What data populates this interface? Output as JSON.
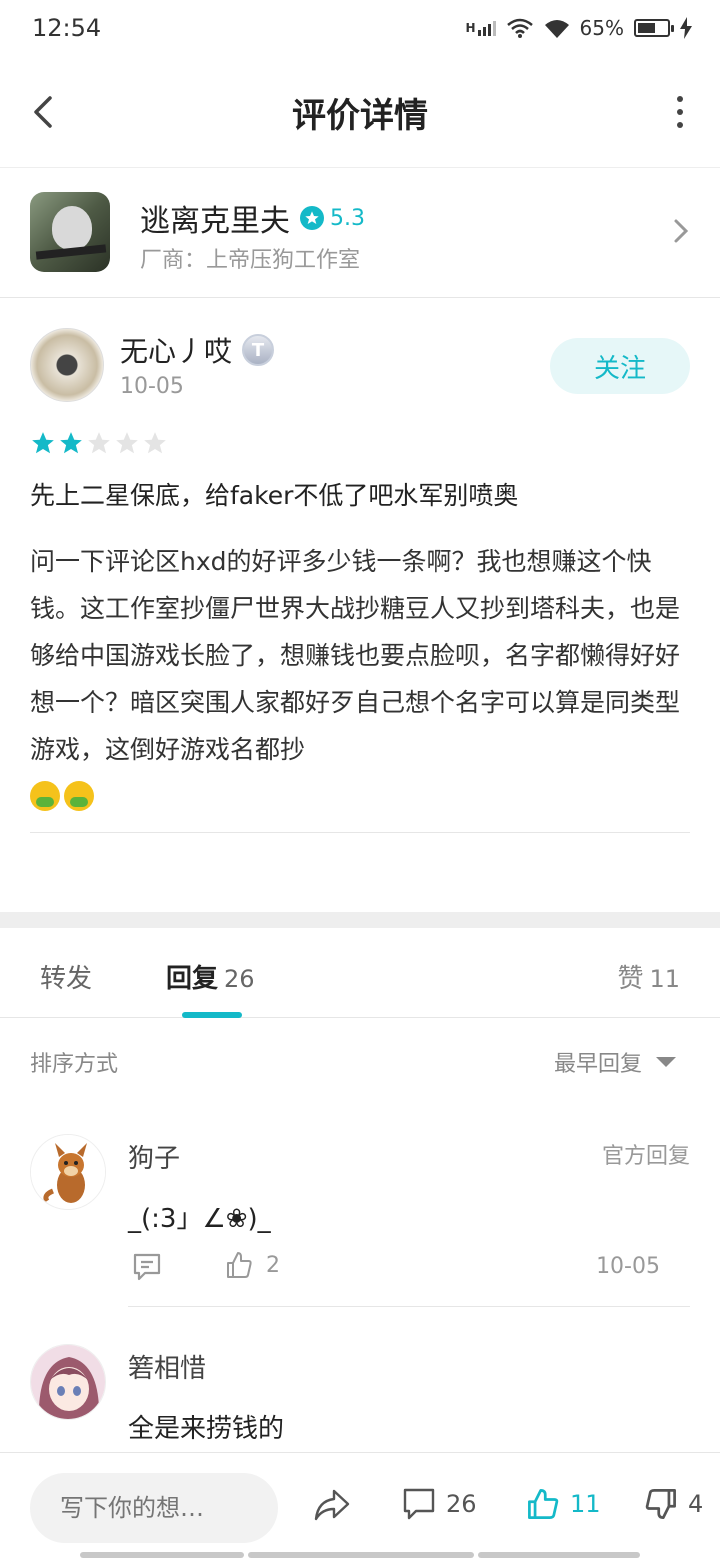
{
  "status_bar": {
    "time": "12:54",
    "network": "H",
    "battery": "65%",
    "battery_level": 0.65
  },
  "header": {
    "title": "评价详情"
  },
  "game": {
    "name": "逃离克里夫",
    "rating": "5.3",
    "vendor": "厂商：上帝压狗工作室"
  },
  "review": {
    "username": "无心丿哎",
    "level_badge": "T",
    "date": "10-05",
    "follow_label": "关注",
    "stars_filled": 2,
    "stars_total": 5,
    "title": "先上二星保底，给faker不低了吧水军别喷奥",
    "body": "问一下评论区hxd的好评多少钱一条啊？我也想赚这个快钱。这工作室抄僵尸世界大战抄糖豆人又抄到塔科夫，也是够给中国游戏长脸了，想赚钱也要点脸呗，名字都懒得好好想一个？暗区突围人家都好歹自己想个名字可以算是同类型游戏，这倒好游戏名都抄"
  },
  "tabs": {
    "forward": "转发",
    "reply": "回复",
    "reply_count": "26",
    "like": "赞",
    "like_count": "11"
  },
  "sort": {
    "label": "排序方式",
    "selected": "最早回复"
  },
  "replies": [
    {
      "name": "狗子",
      "badge": "官方回复",
      "text": "_(:3」∠❀)_",
      "likes": "2",
      "date": "10-05"
    },
    {
      "name": "箬相惜",
      "text": "全是来捞钱的"
    }
  ],
  "bottom_bar": {
    "input_placeholder": "写下你的想…",
    "comment_count": "26",
    "like_count": "11",
    "dislike_count": "4"
  },
  "colors": {
    "accent": "#14b9c8",
    "star_empty": "#e4e4e4"
  }
}
